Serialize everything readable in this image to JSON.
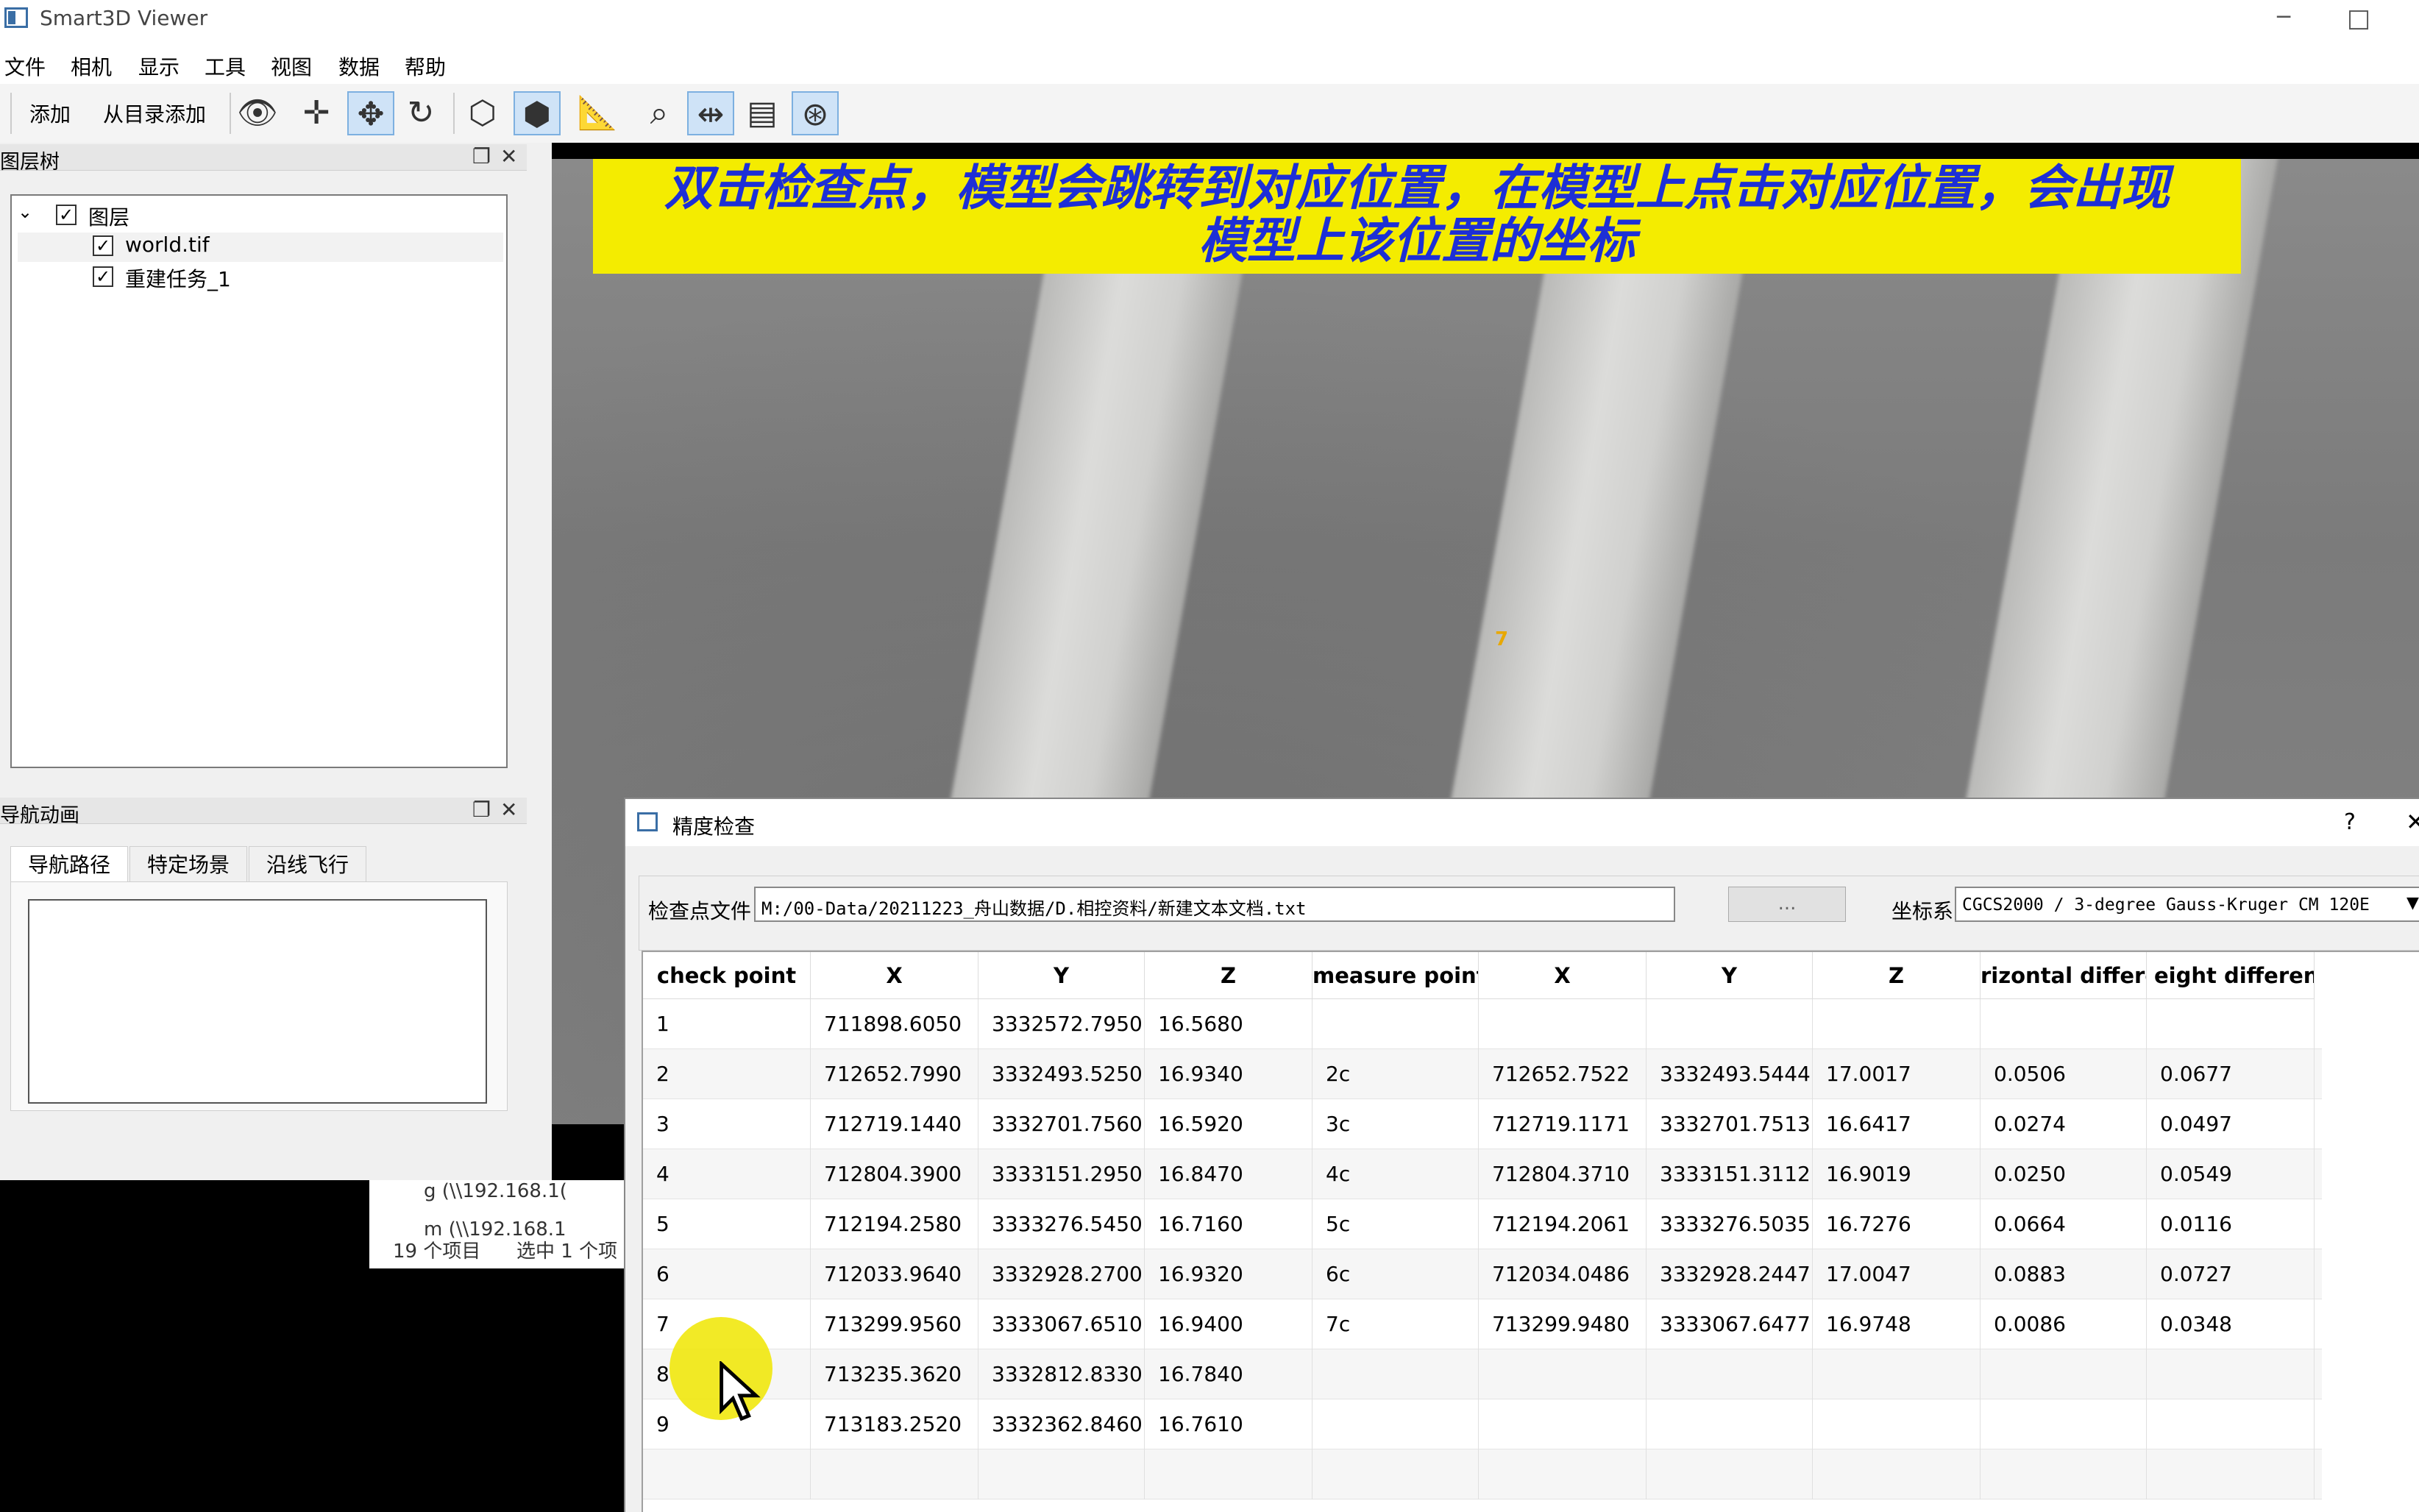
{
  "app": {
    "title": "Smart3D Viewer"
  },
  "menu": [
    "文件",
    "相机",
    "显示",
    "工具",
    "视图",
    "数据",
    "帮助"
  ],
  "toolbar": {
    "add_label": "添加",
    "add_from_dir_label": "从目录添加",
    "icons": [
      "eye-icon",
      "move-icon",
      "orbit-icon",
      "rotate-icon",
      "cube-wire-icon",
      "cube-solid-icon",
      "measure-icon",
      "zoom-select-icon",
      "split-view-icon",
      "document-icon",
      "navigation-icon"
    ]
  },
  "layer_panel": {
    "title": "图层树",
    "root": "图层",
    "items": [
      "world.tif",
      "重建任务_1"
    ]
  },
  "nav_panel": {
    "title": "导航动画",
    "tabs": [
      "导航路径",
      "特定场景",
      "沿线飞行"
    ]
  },
  "caption": {
    "line1": "双击检查点，模型会跳转到对应位置，在模型上点击对应位置，会出现",
    "line2": "模型上该位置的坐标"
  },
  "viewport": {
    "marker": "7"
  },
  "explorer": {
    "row1": "g (\\\\192.168.1(",
    "row2": "m (\\\\192.168.1",
    "status_count": "19 个项目",
    "status_selected": "选中 1 个项"
  },
  "dialog": {
    "title": "精度检查",
    "help": "?",
    "file_label": "检查点文件",
    "file_path": "M:/00-Data/20211223_舟山数据/D.相控资料/新建文本文档.txt",
    "browse_label": "...",
    "crs_label": "坐标系",
    "crs_value": "CGCS2000 / 3-degree Gauss-Kruger CM 120E"
  },
  "table": {
    "headers": [
      "check point",
      "X",
      "Y",
      "Z",
      "measure point",
      "X",
      "Y",
      "Z",
      "rizontal differe",
      "eight differenc"
    ],
    "rows": [
      [
        "1",
        "711898.6050",
        "3332572.7950",
        "16.5680",
        "",
        "",
        "",
        "",
        "",
        ""
      ],
      [
        "2",
        "712652.7990",
        "3332493.5250",
        "16.9340",
        "2c",
        "712652.7522",
        "3332493.5444",
        "17.0017",
        "0.0506",
        "0.0677"
      ],
      [
        "3",
        "712719.1440",
        "3332701.7560",
        "16.5920",
        "3c",
        "712719.1171",
        "3332701.7513",
        "16.6417",
        "0.0274",
        "0.0497"
      ],
      [
        "4",
        "712804.3900",
        "3333151.2950",
        "16.8470",
        "4c",
        "712804.3710",
        "3333151.3112",
        "16.9019",
        "0.0250",
        "0.0549"
      ],
      [
        "5",
        "712194.2580",
        "3333276.5450",
        "16.7160",
        "5c",
        "712194.2061",
        "3333276.5035",
        "16.7276",
        "0.0664",
        "0.0116"
      ],
      [
        "6",
        "712033.9640",
        "3332928.2700",
        "16.9320",
        "6c",
        "712034.0486",
        "3332928.2447",
        "17.0047",
        "0.0883",
        "0.0727"
      ],
      [
        "7",
        "713299.9560",
        "3333067.6510",
        "16.9400",
        "7c",
        "713299.9480",
        "3333067.6477",
        "16.9748",
        "0.0086",
        "0.0348"
      ],
      [
        "8",
        "713235.3620",
        "3332812.8330",
        "16.7840",
        "",
        "",
        "",
        "",
        "",
        ""
      ],
      [
        "9",
        "713183.2520",
        "3332362.8460",
        "16.7610",
        "",
        "",
        "",
        "",
        "",
        ""
      ],
      [
        "",
        "",
        "",
        "",
        "",
        "",
        "",
        "",
        "",
        ""
      ]
    ]
  }
}
